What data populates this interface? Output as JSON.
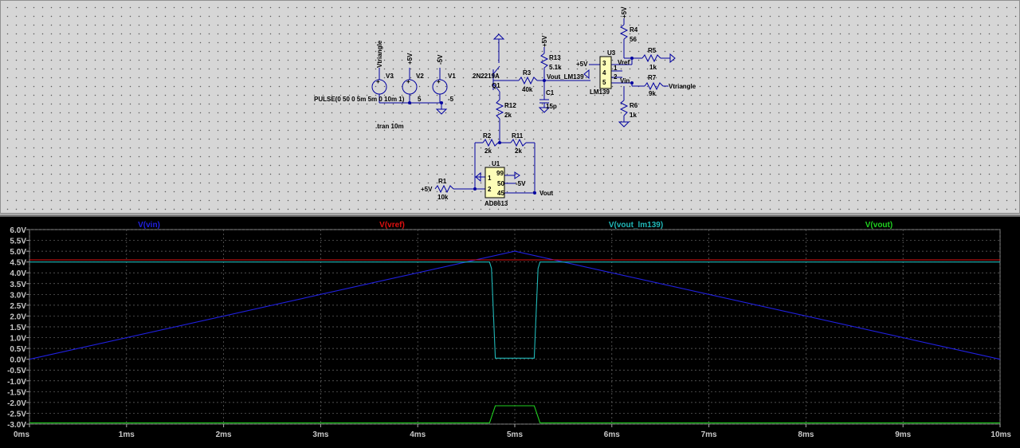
{
  "schematic": {
    "labels": {
      "vtriangle_net": "Vtriangle",
      "v3_value": "+5V",
      "v2_net": "+5V",
      "v1_net": "-5V",
      "v3_name": "V3",
      "v2_name": "V2",
      "v1_name": "V1",
      "pulse_spec": "PULSE(0 50 0 5m 5m 0 10m 1)",
      "v2_value": "5",
      "v1_value": "-5",
      "tran": ".tran 10m",
      "q1_model": "2N2219A",
      "q1_name": "Q1",
      "r13_name": "R13",
      "r13_value": "5.1k",
      "r13_supply": "+5V",
      "r3_name": "R3",
      "r3_value": "40k",
      "vout_lm139_net": "Vout_LM139",
      "c1_name": "C1",
      "c1_value": "15p",
      "r12_name": "R12",
      "r12_value": "2k",
      "r2_name": "R2",
      "r2_value": "2k",
      "r11_name": "R11",
      "r11_value": "2k",
      "u1_name": "U1",
      "u1_model": "AD8613",
      "u1_pin1": "1",
      "u1_pin2": "2",
      "u1_pin99": "99",
      "u1_pin50": "50",
      "u1_pin45": "45",
      "u1_neg": "-5V",
      "vout_net": "Vout",
      "r1_name": "R1",
      "r1_value": "10k",
      "r1_supply": "+5V",
      "u3_name": "U3",
      "u3_model": "LM139",
      "u3_pin3": "3",
      "u3_pin4": "4",
      "u3_pin5": "5",
      "u3_pin1": "1",
      "u3_pin2": "2",
      "u3_supply": "+5V",
      "r4_supply": "+5V",
      "r4_name": "R4",
      "r4_value": "56",
      "vref_net": "Vref",
      "r5_name": "R5",
      "r5_value": "1k",
      "vin_net": "Vin",
      "r7_name": "R7",
      "r7_value": "9k",
      "r7_net": "Vtriangle",
      "r6_name": "R6",
      "r6_value": "1k"
    }
  },
  "waveform": {
    "traces": [
      {
        "name": "V(vin)",
        "color": "#2020e0"
      },
      {
        "name": "V(vref)",
        "color": "#e01010"
      },
      {
        "name": "V(vout_lm139)",
        "color": "#20b8b8"
      },
      {
        "name": "V(vout)",
        "color": "#20d020"
      }
    ],
    "y_ticks": [
      "6.0V",
      "5.5V",
      "5.0V",
      "4.5V",
      "4.0V",
      "3.5V",
      "3.0V",
      "2.5V",
      "2.0V",
      "1.5V",
      "1.0V",
      "0.5V",
      "0.0V",
      "-0.5V",
      "-1.0V",
      "-1.5V",
      "-2.0V",
      "-2.5V",
      "-3.0V"
    ],
    "x_ticks": [
      "0ms",
      "1ms",
      "2ms",
      "3ms",
      "4ms",
      "5ms",
      "6ms",
      "7ms",
      "8ms",
      "9ms",
      "10ms"
    ]
  },
  "chart_data": {
    "type": "line",
    "xlabel": "",
    "ylabel": "",
    "xlim": [
      0,
      10
    ],
    "ylim": [
      -3.0,
      6.0
    ],
    "x_unit": "ms",
    "y_unit": "V",
    "grid": true,
    "series": [
      {
        "name": "V(vin)",
        "color": "#2020e0",
        "x": [
          0,
          5,
          10
        ],
        "y": [
          0.0,
          5.0,
          0.0
        ]
      },
      {
        "name": "V(vref)",
        "color": "#e01010",
        "x": [
          0,
          10
        ],
        "y": [
          4.6,
          4.6
        ]
      },
      {
        "name": "V(vout_lm139)",
        "color": "#20b8b8",
        "x": [
          0,
          4.74,
          4.76,
          4.8,
          5.2,
          5.24,
          5.26,
          10
        ],
        "y": [
          4.5,
          4.5,
          4.2,
          0.05,
          0.05,
          4.2,
          4.5,
          4.5
        ]
      },
      {
        "name": "V(vout)",
        "color": "#20d020",
        "x": [
          0,
          4.74,
          4.8,
          5.2,
          5.26,
          10
        ],
        "y": [
          -2.95,
          -2.95,
          -2.15,
          -2.15,
          -2.95,
          -2.95
        ]
      }
    ]
  }
}
